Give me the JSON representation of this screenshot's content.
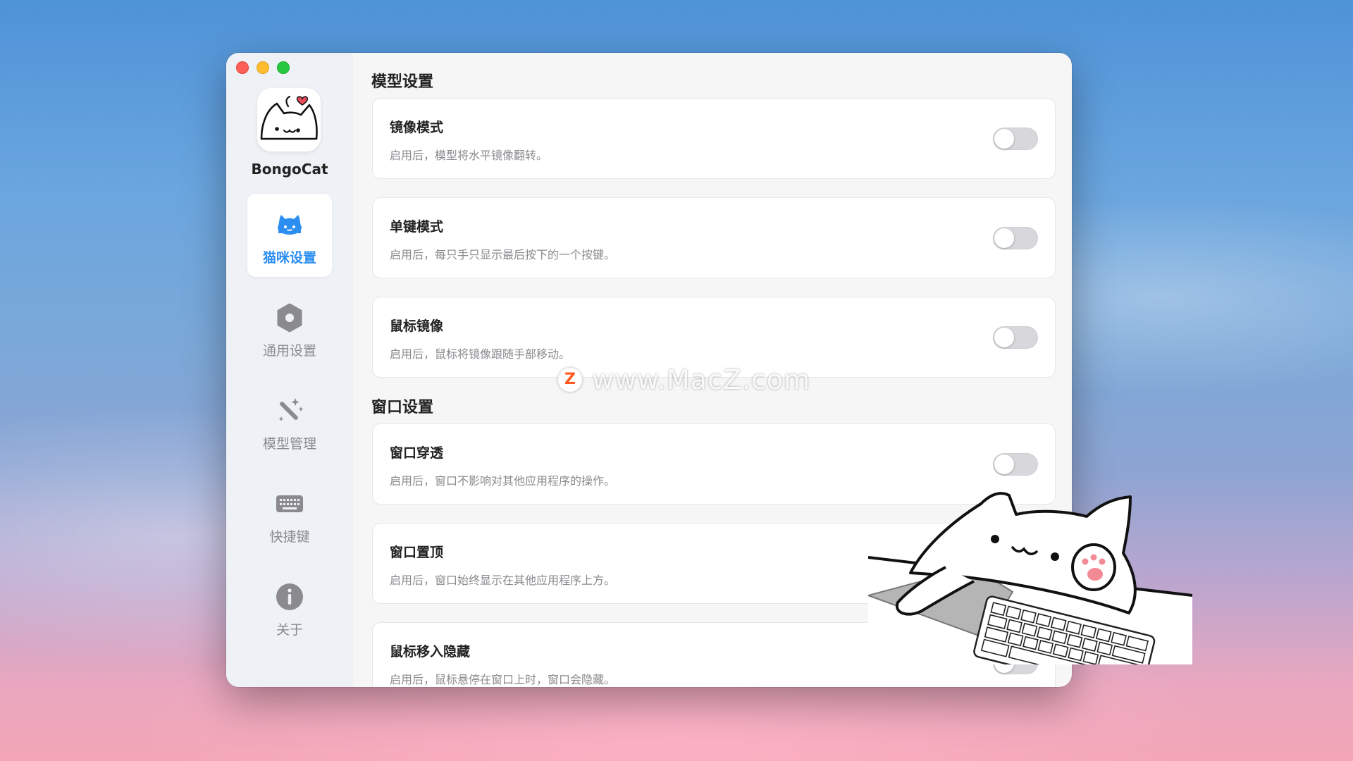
{
  "app": {
    "name": "BongoCat"
  },
  "sidebar": {
    "items": [
      {
        "label": "猫咪设置",
        "icon": "cat-icon",
        "active": true
      },
      {
        "label": "通用设置",
        "icon": "gear-icon",
        "active": false
      },
      {
        "label": "模型管理",
        "icon": "magic-wand-icon",
        "active": false
      },
      {
        "label": "快捷键",
        "icon": "keyboard-icon",
        "active": false
      },
      {
        "label": "关于",
        "icon": "info-icon",
        "active": false
      }
    ]
  },
  "sections": [
    {
      "title": "模型设置",
      "items": [
        {
          "title": "镜像模式",
          "desc": "启用后，模型将水平镜像翻转。",
          "enabled": false
        },
        {
          "title": "单键模式",
          "desc": "启用后，每只手只显示最后按下的一个按键。",
          "enabled": false
        },
        {
          "title": "鼠标镜像",
          "desc": "启用后，鼠标将镜像跟随手部移动。",
          "enabled": false
        }
      ]
    },
    {
      "title": "窗口设置",
      "items": [
        {
          "title": "窗口穿透",
          "desc": "启用后，窗口不影响对其他应用程序的操作。",
          "enabled": false
        },
        {
          "title": "窗口置顶",
          "desc": "启用后，窗口始终显示在其他应用程序上方。",
          "enabled": false
        },
        {
          "title": "鼠标移入隐藏",
          "desc": "启用后，鼠标悬停在窗口上时，窗口会隐藏。",
          "enabled": false
        }
      ]
    }
  ],
  "watermark": {
    "text": "www.MacZ.com",
    "badge": "Z"
  },
  "colors": {
    "accent": "#2c8ef0",
    "toggle_off": "#d8d8dc"
  }
}
